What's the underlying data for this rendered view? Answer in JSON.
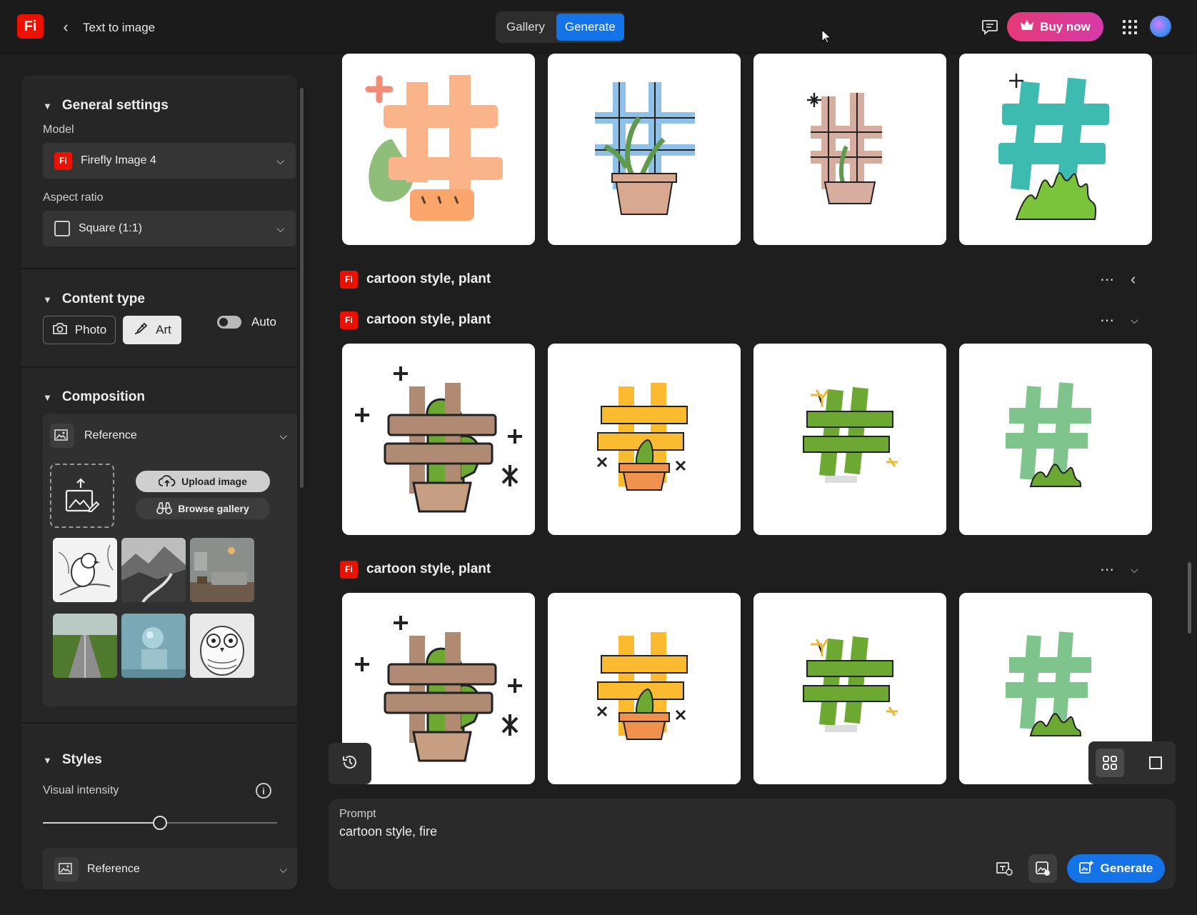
{
  "app": {
    "logo": "Fi",
    "title": "Text to image"
  },
  "top_tabs": [
    {
      "label": "Gallery",
      "active": false
    },
    {
      "label": "Generate",
      "active": true
    }
  ],
  "header": {
    "buy_label": "Buy now",
    "icons": [
      "feedback-icon",
      "crown-icon",
      "apps-grid-icon",
      "avatar"
    ]
  },
  "sidebar": {
    "general": {
      "title": "General settings",
      "model_label": "Model",
      "model_value": "Firefly Image 4",
      "aspect_label": "Aspect ratio",
      "aspect_value": "Square (1:1)"
    },
    "content_type": {
      "title": "Content type",
      "photo_label": "Photo",
      "art_label": "Art",
      "art_selected": true,
      "auto_label": "Auto",
      "auto_on": true
    },
    "composition": {
      "title": "Composition",
      "reference_label": "Reference",
      "upload_label": "Upload image",
      "browse_label": "Browse gallery",
      "thumbnails": [
        "bird-sketch",
        "misty-mountains",
        "living-room",
        "country-road",
        "sphere-on-cube",
        "owl-sketch"
      ]
    },
    "styles": {
      "title": "Styles",
      "intensity_label": "Visual intensity",
      "intensity_value": 0.5,
      "reference_label": "Reference"
    }
  },
  "groups": [
    {
      "prompt": "",
      "collapsed": false,
      "images": [
        "orange-hash-plant",
        "blue-hash-pot",
        "tan-hash-pot",
        "teal-hash-grass"
      ]
    },
    {
      "prompt": "cartoon style, plant",
      "collapsed": true,
      "images": []
    },
    {
      "prompt": "cartoon style, plant",
      "collapsed": false,
      "images": [
        "brown-hash-cactus",
        "yellow-hash-cactus",
        "green-hash",
        "mint-hash-grass"
      ]
    },
    {
      "prompt": "cartoon style, plant",
      "collapsed": false,
      "images": [
        "brown-hash-cactus",
        "yellow-hash-cactus",
        "green-hash",
        "mint-hash-grass"
      ]
    }
  ],
  "prompt": {
    "label": "Prompt",
    "text": "cartoon style, fire",
    "generate_label": "Generate"
  },
  "colors": {
    "accent": "#1473e6",
    "brand": "#eb1000",
    "buy_start": "#e43a76",
    "buy_end": "#d63aa8"
  }
}
